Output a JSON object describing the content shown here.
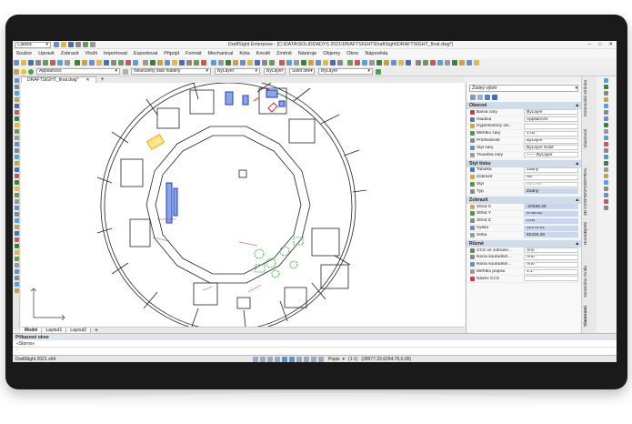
{
  "app": {
    "workspace": "Classic",
    "window_title": "DraftSight Enterprise - [C:\\DATA\\SOLIDDADYS 2021\\DRAFTSIGHT\\DraftSight\\DRAFTSIGHT_final.dwg*]"
  },
  "menu": [
    "Soubor",
    "Upravit",
    "Zobrazit",
    "Vložit",
    "Importovat",
    "Exportovat",
    "Připojit",
    "Formát",
    "Mechanical",
    "Kóta",
    "Kreslit",
    "Změnit",
    "Nástroje",
    "Objemy",
    "Okno",
    "Nápověda"
  ],
  "layerbar": {
    "layer": "Appliances",
    "layer_state": "Neuložený stav hladiny",
    "color": "ByLayer",
    "linetype": "ByLayer",
    "linestyle": "Solid line",
    "lineweight": "ByLayer"
  },
  "document_tab": "DRAFTSIGHT_final.dwg*",
  "layout_tabs": [
    "Model",
    "Layout1",
    "Layout2"
  ],
  "command": {
    "header": "Příkazové okno",
    "line": "«Storno»",
    "prompt": ":"
  },
  "status": {
    "version": "DraftSight 2021 x64",
    "annotation": "Popis",
    "scale": "(1:1)",
    "coords": "(28977.33,6294.76,0.00)"
  },
  "properties": {
    "selection": "Žádný výběr",
    "sections": [
      {
        "title": "Obecné",
        "rows": [
          {
            "label": "Barva čáry",
            "value": "ByLayer",
            "style": ""
          },
          {
            "label": "Hladina",
            "value": "Appliances",
            "style": ""
          },
          {
            "label": "Hypertextový od...",
            "value": "",
            "style": ""
          },
          {
            "label": "Měřítko čáry",
            "value": "1.00",
            "style": ""
          },
          {
            "label": "Průhlednost",
            "value": "ByLayer",
            "style": ""
          },
          {
            "label": "Styl čáry",
            "value": "ByLayer     Solid",
            "style": ""
          },
          {
            "label": "Tloušťka čáry",
            "value": "—— ByLayer",
            "style": ""
          }
        ]
      },
      {
        "title": "Styl tisku",
        "rows": [
          {
            "label": "Tabulka",
            "value": "Žádný",
            "style": ""
          },
          {
            "label": "Zobrazit",
            "value": "Ne",
            "style": ""
          },
          {
            "label": "Styl",
            "value": "ByColor",
            "style": "dis"
          },
          {
            "label": "Typ",
            "value": "Žádný",
            "style": "blue"
          }
        ]
      },
      {
        "title": "Zobrazit",
        "rows": [
          {
            "label": "Střed X",
            "value": "-20566.28",
            "style": "blue"
          },
          {
            "label": "Střed Y",
            "value": "9788.82",
            "style": "blue"
          },
          {
            "label": "Střed Z",
            "value": "0.00",
            "style": "blue"
          },
          {
            "label": "Výška",
            "value": "32170.41",
            "style": "blue"
          },
          {
            "label": "Šířka",
            "value": "62425.39",
            "style": "blue"
          }
        ]
      },
      {
        "title": "Různé",
        "rows": [
          {
            "label": "CCS ve zobraze...",
            "value": "Ano",
            "style": ""
          },
          {
            "label": "Ikona souřadnih...",
            "value": "Ano",
            "style": ""
          },
          {
            "label": "Ikona souřadnih...",
            "value": "Ano",
            "style": ""
          },
          {
            "label": "Měřítko popisu",
            "value": "1:1",
            "style": ""
          },
          {
            "label": "Název CCS",
            "value": "",
            "style": ""
          }
        ]
      }
    ]
  },
  "side_tabs": [
    "Domovská stránka",
    "Vlastnosti",
    "3D CONTENTCENTRAL",
    "HomeByMe",
    "Generátor Gridu",
    "Vlastnosti"
  ],
  "colors": {
    "frame": "#1a1a1a",
    "section": "#cfdcea",
    "accent": "#c8d7ee"
  }
}
